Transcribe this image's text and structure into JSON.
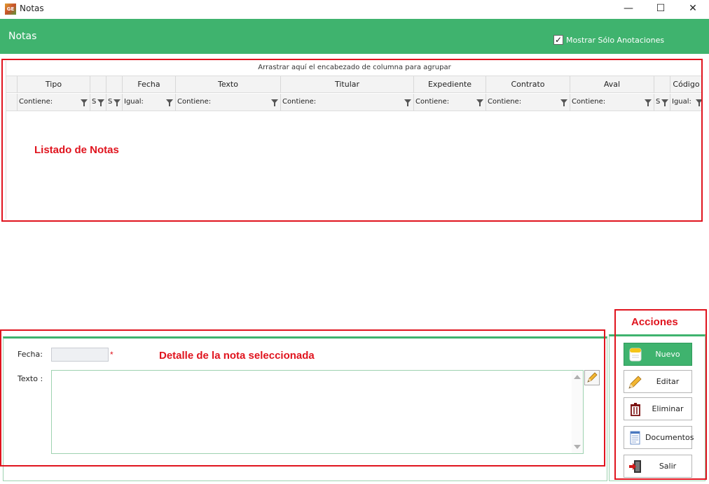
{
  "window": {
    "icon_text": "GE",
    "title": "Notas",
    "minimize": "—",
    "maximize": "☐",
    "close": "✕"
  },
  "header": {
    "title": "Notas",
    "checkbox_label": "Mostrar Sólo Anotaciones",
    "checkbox_checked": true
  },
  "grid": {
    "group_panel": "Arrastrar aquí el encabezado de columna para agrupar",
    "columns": [
      {
        "header": "",
        "filter": ""
      },
      {
        "header": "Tipo",
        "filter": "Contiene:"
      },
      {
        "header": "",
        "filter": "S"
      },
      {
        "header": "",
        "filter": "S"
      },
      {
        "header": "Fecha",
        "filter": "Igual:"
      },
      {
        "header": "Texto",
        "filter": "Contiene:"
      },
      {
        "header": "Titular",
        "filter": "Contiene:"
      },
      {
        "header": "Expediente",
        "filter": "Contiene:"
      },
      {
        "header": "Contrato",
        "filter": "Contiene:"
      },
      {
        "header": "Aval",
        "filter": "Contiene:"
      },
      {
        "header": "",
        "filter": "S"
      },
      {
        "header": "Código",
        "filter": "Igual:"
      }
    ],
    "rows": []
  },
  "annotations": {
    "listado": "Listado de Notas",
    "detalle": "Detalle de la nota seleccionada",
    "acciones": "Acciones"
  },
  "detail": {
    "fecha_label": "Fecha:",
    "fecha_value": "",
    "required_mark": "*",
    "texto_label": "Texto :",
    "texto_value": ""
  },
  "actions": {
    "nuevo": "Nuevo",
    "editar": "Editar",
    "eliminar": "Eliminar",
    "documentos": "Documentos",
    "salir": "Salir"
  },
  "colors": {
    "accent": "#3fb36e",
    "annotation": "#e0141e"
  }
}
